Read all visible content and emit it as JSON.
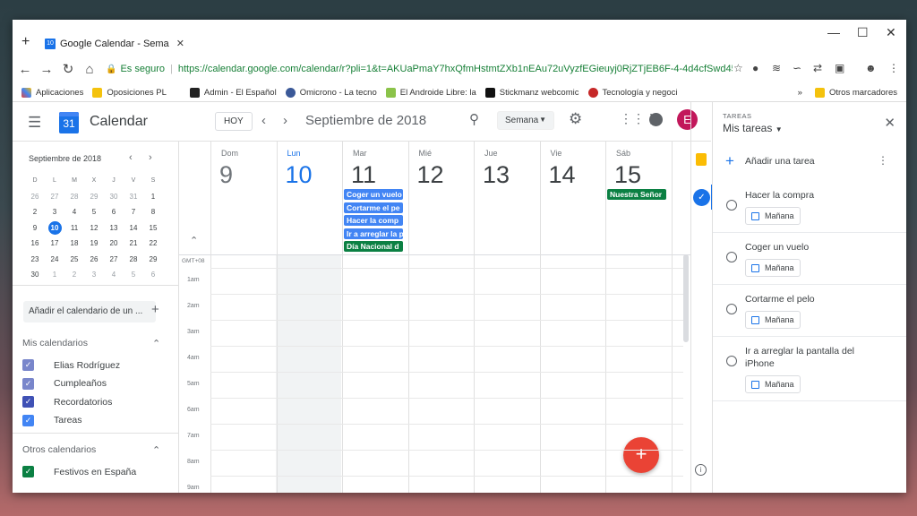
{
  "browser": {
    "tab_title": "Google Calendar - Sema",
    "tab_favicon": "10",
    "secure_label": "Es seguro",
    "url": "https://calendar.google.com/calendar/r?pli=1&t=AKUaPmaY7hxQfmHstmtZXb1nEAu72uVyzfEGieuyj0RjZTjEB6F-4-4d4cfSwd45S6-gaFdj...",
    "bookmarks": [
      "Aplicaciones",
      "Oposiciones PL",
      "Admin - El Español",
      "Omicrono - La tecno",
      "El Androide Libre: la",
      "Stickmanz webcomic",
      "Tecnología y negoci"
    ],
    "bookmarks_more": "»",
    "other_bookmarks": "Otros marcadores"
  },
  "header": {
    "app_title": "Calendar",
    "logo_day": "31",
    "today_button": "HOY",
    "month_title": "Septiembre de 2018",
    "view_selector": "Semana",
    "avatar_letter": "E"
  },
  "mini_calendar": {
    "title": "Septiembre de 2018",
    "weekdays": [
      "D",
      "L",
      "M",
      "X",
      "J",
      "V",
      "S"
    ],
    "weeks": [
      [
        "26",
        "27",
        "28",
        "29",
        "30",
        "31",
        "1"
      ],
      [
        "2",
        "3",
        "4",
        "5",
        "6",
        "7",
        "8"
      ],
      [
        "9",
        "10",
        "11",
        "12",
        "13",
        "14",
        "15"
      ],
      [
        "16",
        "17",
        "18",
        "19",
        "20",
        "21",
        "22"
      ],
      [
        "23",
        "24",
        "25",
        "26",
        "27",
        "28",
        "29"
      ],
      [
        "30",
        "1",
        "2",
        "3",
        "4",
        "5",
        "6"
      ]
    ],
    "today": "10"
  },
  "sidebar": {
    "add_calendar_placeholder": "Añadir el calendario de un ...",
    "my_calendars_title": "Mis calendarios",
    "my_calendars": [
      {
        "label": "Elias Rodríguez",
        "color": "#7986cb"
      },
      {
        "label": "Cumpleaños",
        "color": "#7986cb"
      },
      {
        "label": "Recordatorios",
        "color": "#3f51b5"
      },
      {
        "label": "Tareas",
        "color": "#4285f4"
      }
    ],
    "other_calendars_title": "Otros calendarios",
    "other_calendars": [
      {
        "label": "Festivos en España",
        "color": "#0b8043"
      }
    ]
  },
  "week": {
    "days": [
      {
        "name": "Dom",
        "num": "9"
      },
      {
        "name": "Lun",
        "num": "10"
      },
      {
        "name": "Mar",
        "num": "11"
      },
      {
        "name": "Mié",
        "num": "12"
      },
      {
        "name": "Jue",
        "num": "13"
      },
      {
        "name": "Vie",
        "num": "14"
      },
      {
        "name": "Sáb",
        "num": "15"
      }
    ],
    "events": [
      {
        "day": "Mar",
        "label": "Coger un vuelo",
        "color": "#4285f4"
      },
      {
        "day": "Mar",
        "label": "Cortarme el pe",
        "color": "#4285f4"
      },
      {
        "day": "Mar",
        "label": "Hacer la comp",
        "color": "#4285f4"
      },
      {
        "day": "Mar",
        "label": "Ir a arreglar la p",
        "color": "#4285f4"
      },
      {
        "day": "Mar",
        "label": "Día Nacional d",
        "color": "#0b8043"
      },
      {
        "day": "Sáb",
        "label": "Nuestra Señor",
        "color": "#0b8043"
      }
    ],
    "timezone": "GMT+08",
    "hours": [
      "1am",
      "2am",
      "3am",
      "4am",
      "5am",
      "6am",
      "7am",
      "8am",
      "9am"
    ],
    "fab_label": "+"
  },
  "tasks": {
    "section_label": "TAREAS",
    "list_name": "Mis tareas",
    "add_label": "Añadir una tarea",
    "items": [
      {
        "title": "Hacer la compra",
        "date": "Mañana"
      },
      {
        "title": "Coger un vuelo",
        "date": "Mañana"
      },
      {
        "title": "Cortarme el pelo",
        "date": "Mañana"
      },
      {
        "title": "Ir a arreglar la pantalla del iPhone",
        "date": "Mañana"
      }
    ]
  }
}
